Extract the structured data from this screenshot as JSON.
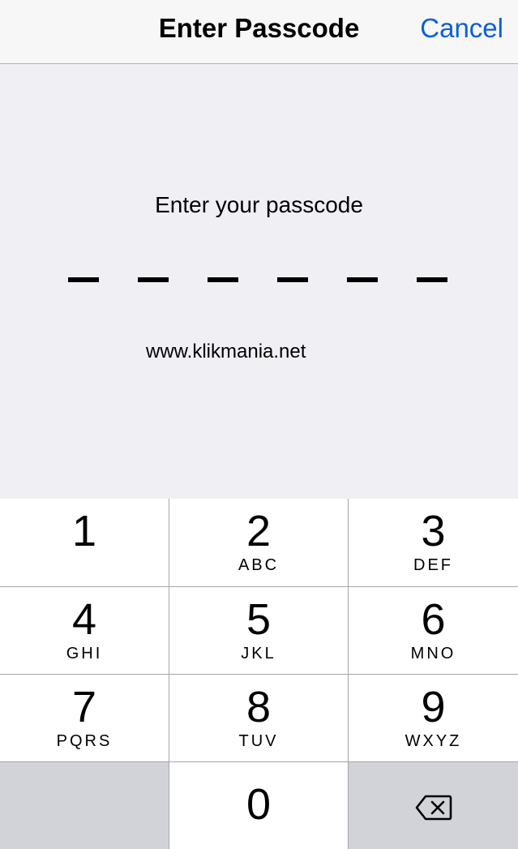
{
  "nav": {
    "title": "Enter Passcode",
    "cancel_label": "Cancel"
  },
  "prompt": "Enter your passcode",
  "passcode_length": 6,
  "watermark": "www.klikmania.net",
  "keypad": {
    "keys": [
      {
        "digit": "1",
        "letters": ""
      },
      {
        "digit": "2",
        "letters": "ABC"
      },
      {
        "digit": "3",
        "letters": "DEF"
      },
      {
        "digit": "4",
        "letters": "GHI"
      },
      {
        "digit": "5",
        "letters": "JKL"
      },
      {
        "digit": "6",
        "letters": "MNO"
      },
      {
        "digit": "7",
        "letters": "PQRS"
      },
      {
        "digit": "8",
        "letters": "TUV"
      },
      {
        "digit": "9",
        "letters": "WXYZ"
      },
      {
        "digit": "0",
        "letters": ""
      }
    ],
    "delete_icon": "backspace-icon"
  },
  "colors": {
    "accent": "#0a5fd8",
    "background": "#efeff4",
    "key_gray": "#d1d3d8"
  }
}
